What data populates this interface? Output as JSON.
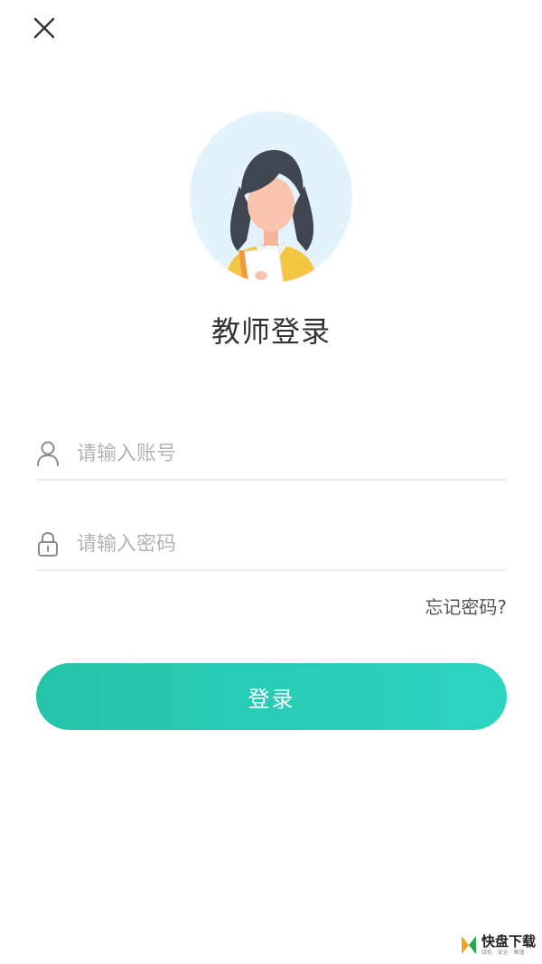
{
  "header": {
    "close_icon": "close-icon"
  },
  "avatar": {
    "icon": "teacher-avatar-icon",
    "bg_color": "#e3f3fb"
  },
  "title": "教师登录",
  "account": {
    "placeholder": "请输入账号",
    "value": "",
    "icon": "user-icon"
  },
  "password": {
    "placeholder": "请输入密码",
    "value": "",
    "icon": "lock-icon"
  },
  "forgot_label": "忘记密码?",
  "login_label": "登录",
  "colors": {
    "accent_start": "#24c4a9",
    "accent_end": "#2dd5c1",
    "divider": "#ececec",
    "placeholder": "#b3b3b3"
  },
  "watermark": {
    "main": "快盘下载",
    "sub": "绿色 · 安全 · 高速"
  }
}
